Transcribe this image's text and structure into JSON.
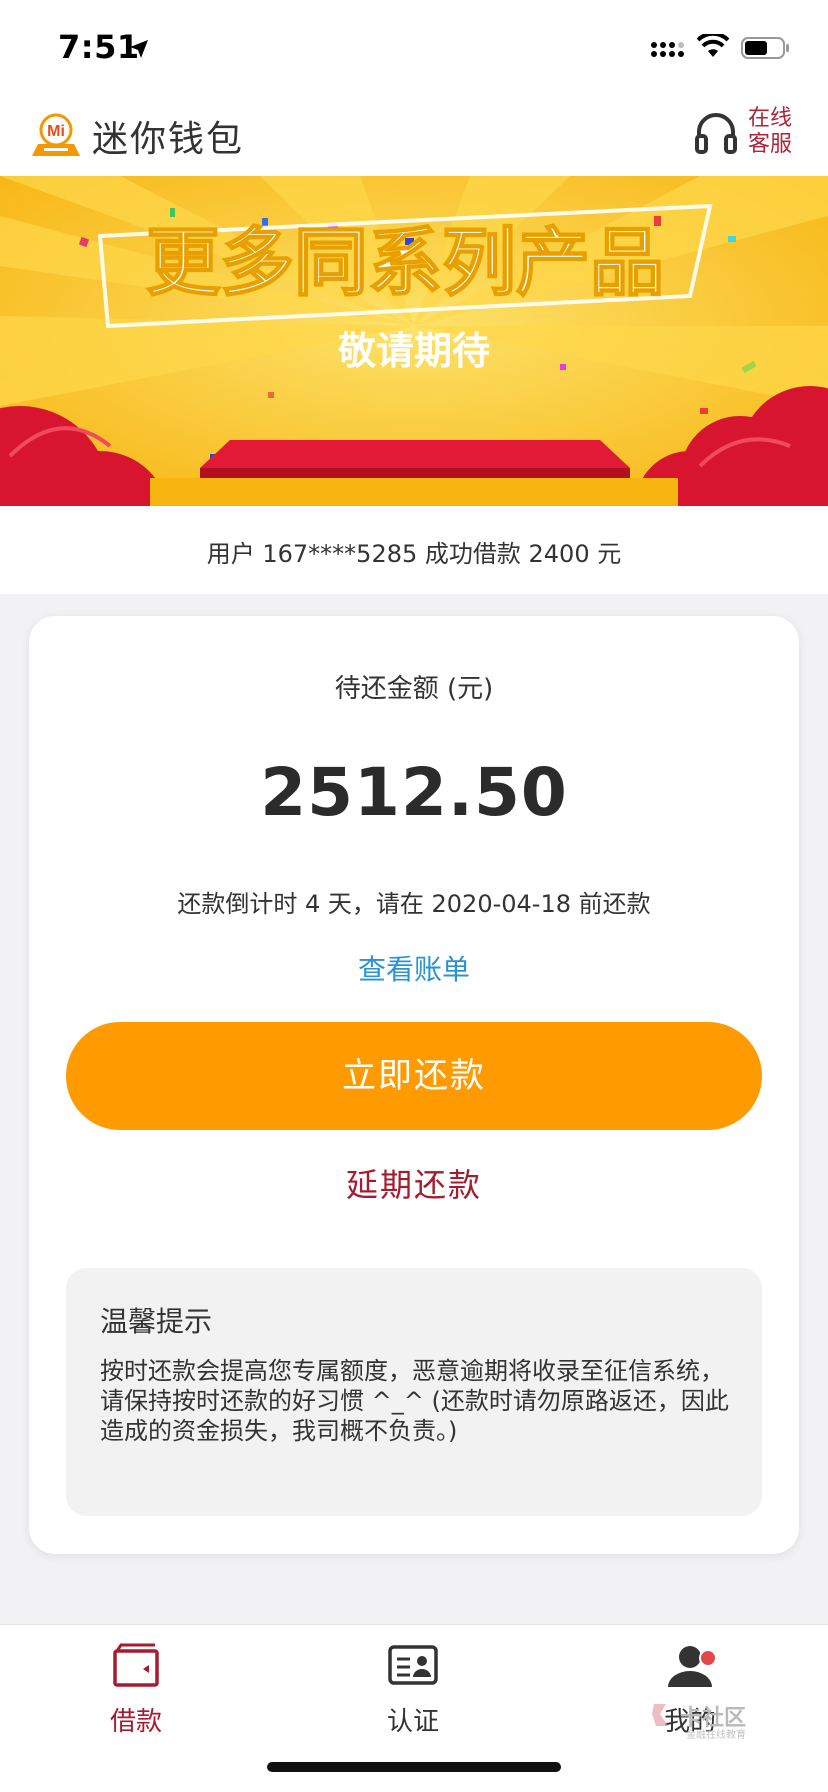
{
  "status_bar": {
    "time": "7:51"
  },
  "header": {
    "title": "迷你钱包",
    "customer_service": "在线客服",
    "logo_text": "Mi"
  },
  "banner": {
    "headline": "更多同系列产品",
    "subline": "敬请期待"
  },
  "ticker": {
    "text": "用户 167****5285 成功借款 2400 元"
  },
  "repayment": {
    "amount_label": "待还金额 (元)",
    "amount": "2512.50",
    "due_text": "还款倒计时 4 天，请在 2020-04-18 前还款",
    "view_bill": "查看账单",
    "repay_now": "立即还款",
    "extend": "延期还款"
  },
  "tips": {
    "title": "温馨提示",
    "body": "按时还款会提高您专属额度，恶意逾期将收录至征信系统，请保持按时还款的好习惯 ^_^ (还款时请勿原路返还，因此造成的资金损失，我司概不负责。)"
  },
  "tabs": [
    {
      "label": "借款",
      "icon": "wallet-icon",
      "active": true
    },
    {
      "label": "认证",
      "icon": "id-card-icon",
      "active": false
    },
    {
      "label": "我的",
      "icon": "user-icon",
      "active": false
    }
  ],
  "watermark": {
    "text": "卡社区",
    "sub": "金融在线教育"
  },
  "colors": {
    "accent_orange": "#ff9a00",
    "brand_red": "#a61c2f",
    "link_blue": "#2a93d5",
    "banner_yellow": "#fbc21a",
    "banner_red": "#d8152f"
  }
}
